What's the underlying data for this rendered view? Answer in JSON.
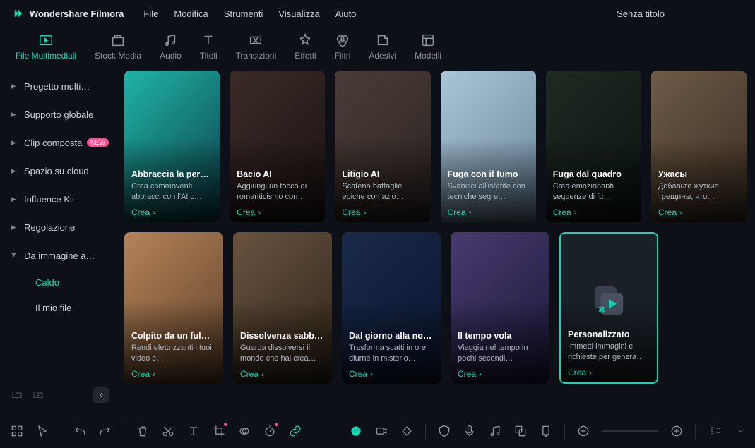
{
  "app": {
    "name": "Wondershare Filmora",
    "project_title": "Senza titolo"
  },
  "menu": [
    "File",
    "Modifica",
    "Strumenti",
    "Visualizza",
    "Aiuto"
  ],
  "tabs": [
    {
      "id": "media",
      "label": "File Multimediali",
      "active": true
    },
    {
      "id": "stock",
      "label": "Stock Media"
    },
    {
      "id": "audio",
      "label": "Audio"
    },
    {
      "id": "titles",
      "label": "Titoli"
    },
    {
      "id": "transitions",
      "label": "Transizioni"
    },
    {
      "id": "effects",
      "label": "Effetti"
    },
    {
      "id": "filters",
      "label": "Filtri"
    },
    {
      "id": "stickers",
      "label": "Adesivi"
    },
    {
      "id": "templates",
      "label": "Modelli"
    }
  ],
  "sidebar": {
    "items": [
      {
        "label": "Progetto multi…"
      },
      {
        "label": "Supporto globale"
      },
      {
        "label": "Clip composta",
        "badge": "NEW"
      },
      {
        "label": "Spazio su cloud"
      },
      {
        "label": "Influence Kit"
      },
      {
        "label": "Regolazione"
      },
      {
        "label": "Da immagine a…",
        "expanded": true
      }
    ],
    "sub": [
      {
        "label": "Caldo",
        "active": true
      },
      {
        "label": "Il mio file"
      }
    ]
  },
  "cards": [
    {
      "title": "Abbraccia la person…",
      "desc": "Crea commoventi abbracci con l'AI c…",
      "action": "Crea"
    },
    {
      "title": "Bacio AI",
      "desc": "Aggiungi un tocco di romanticismo con…",
      "action": "Crea"
    },
    {
      "title": "Litigio AI",
      "desc": "Scatena battaglie epiche con azio…",
      "action": "Crea"
    },
    {
      "title": "Fuga con il fumo",
      "desc": "Svanisci all'istante con tecniche segre…",
      "action": "Crea"
    },
    {
      "title": "Fuga dal quadro",
      "desc": "Crea emozionanti sequenze di fu…",
      "action": "Crea"
    },
    {
      "title": "Ужасы",
      "desc": "Добавьте жуткие трещины, что…",
      "action": "Crea"
    },
    {
      "title": "Colpito da un fulmine",
      "desc": "Rendi elettrizzanti i tuoi video c…",
      "action": "Crea"
    },
    {
      "title": "Dissolvenza sabbiosa",
      "desc": "Guarda dissolversi il mondo che hai crea…",
      "action": "Crea"
    },
    {
      "title": "Dal giorno alla notte",
      "desc": "Trasforma scatti in ore diurne in misterio…",
      "action": "Crea"
    },
    {
      "title": "Il tempo vola",
      "desc": "Viaggia nel tempo in pochi secondi…",
      "action": "Crea"
    },
    {
      "title": "Personalizzato",
      "desc": "Immetti immagini e richieste per genera…",
      "action": "Crea",
      "custom": true
    }
  ]
}
